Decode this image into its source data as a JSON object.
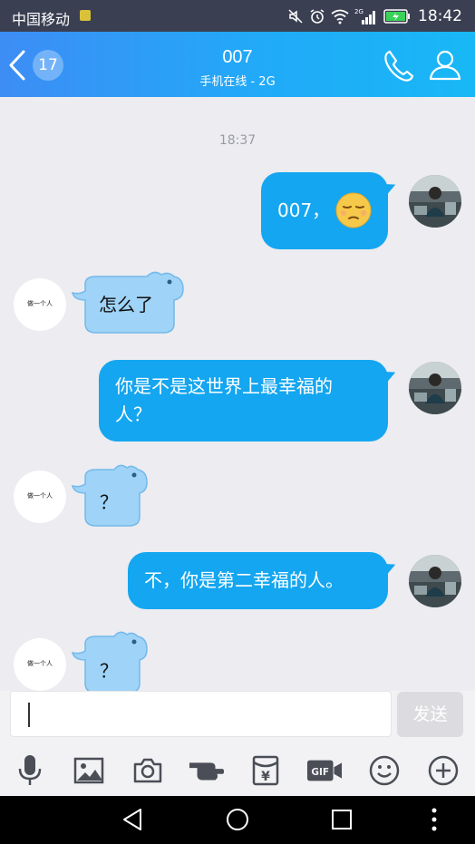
{
  "status_bar": {
    "carrier": "中国移动",
    "network_badge": "2G",
    "time": "18:42"
  },
  "header": {
    "unread_count": "17",
    "contact_name": "007",
    "contact_status": "手机在线 - 2G"
  },
  "chat": {
    "timestamp": "18:37",
    "other_avatar_text": "做一个人",
    "messages": [
      {
        "from": "me",
        "text": "007，",
        "emoji": "pensive-face"
      },
      {
        "from": "other",
        "text": "怎么了"
      },
      {
        "from": "me",
        "text_line1": "你是不是这世界上最幸福的",
        "text_line2": "人？"
      },
      {
        "from": "other",
        "text": "？"
      },
      {
        "from": "me",
        "text": "不，你是第二幸福的人。"
      },
      {
        "from": "other",
        "text": "？"
      }
    ]
  },
  "input": {
    "value": "",
    "send_label": "发送"
  },
  "toolbar": {
    "gif_label": "GIF",
    "items": [
      "microphone-icon",
      "image-icon",
      "camera-icon",
      "poke-icon",
      "red-packet-icon",
      "gif-icon",
      "emoji-icon",
      "plus-icon"
    ]
  },
  "colors": {
    "accent": "#14a6f0",
    "header_start": "#3d8df5",
    "header_end": "#18b8f6",
    "hippo_bubble": "#9fd3f7"
  }
}
